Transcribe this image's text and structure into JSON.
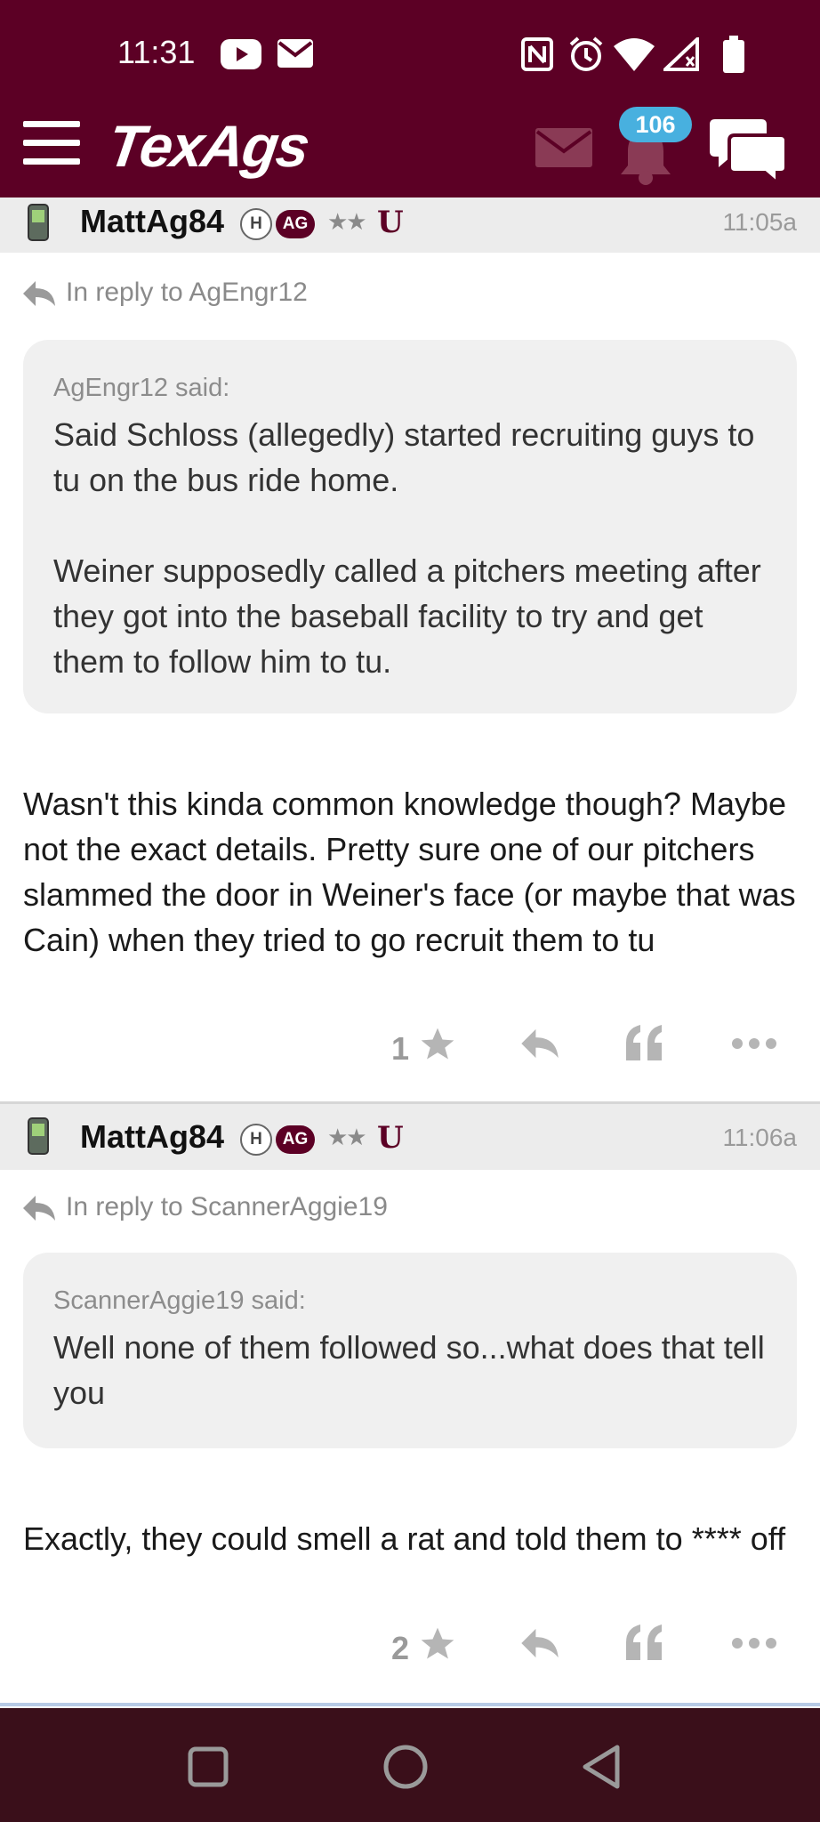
{
  "status_bar": {
    "time": "11:31"
  },
  "header": {
    "logo": "TexAgs",
    "notification_count": "106"
  },
  "posts": [
    {
      "username": "MattAg84",
      "badge_h": "H",
      "badge_ag": "AG",
      "stars": "★★",
      "badge_u": "U",
      "time": "11:05a",
      "reply_to": "In reply to AgEngr12",
      "quote_author": "AgEngr12 said:",
      "quote_paragraphs": [
        "Said Schloss (allegedly) started recruiting guys to tu on the bus ride home.",
        "Weiner supposedly called a pitchers meeting after they got into the baseball facility to try and get them to follow him to tu."
      ],
      "body": "Wasn't this kinda common knowledge though? Maybe not the exact details. Pretty sure one of our pitchers slammed the door in Weiner's face (or maybe that was Cain) when they tried to go recruit them to tu",
      "star_count": "1"
    },
    {
      "username": "MattAg84",
      "badge_h": "H",
      "badge_ag": "AG",
      "stars": "★★",
      "badge_u": "U",
      "time": "11:06a",
      "reply_to": "In reply to ScannerAggie19",
      "quote_author": "ScannerAggie19 said:",
      "quote_paragraphs": [
        "Well none of them followed so...what does that tell you"
      ],
      "body": "Exactly, they could smell a rat and told them to **** off",
      "star_count": "2"
    }
  ],
  "colors": {
    "brand_maroon": "#5c0025",
    "badge_blue": "#48b0df",
    "navbar": "#3a0f1a"
  }
}
